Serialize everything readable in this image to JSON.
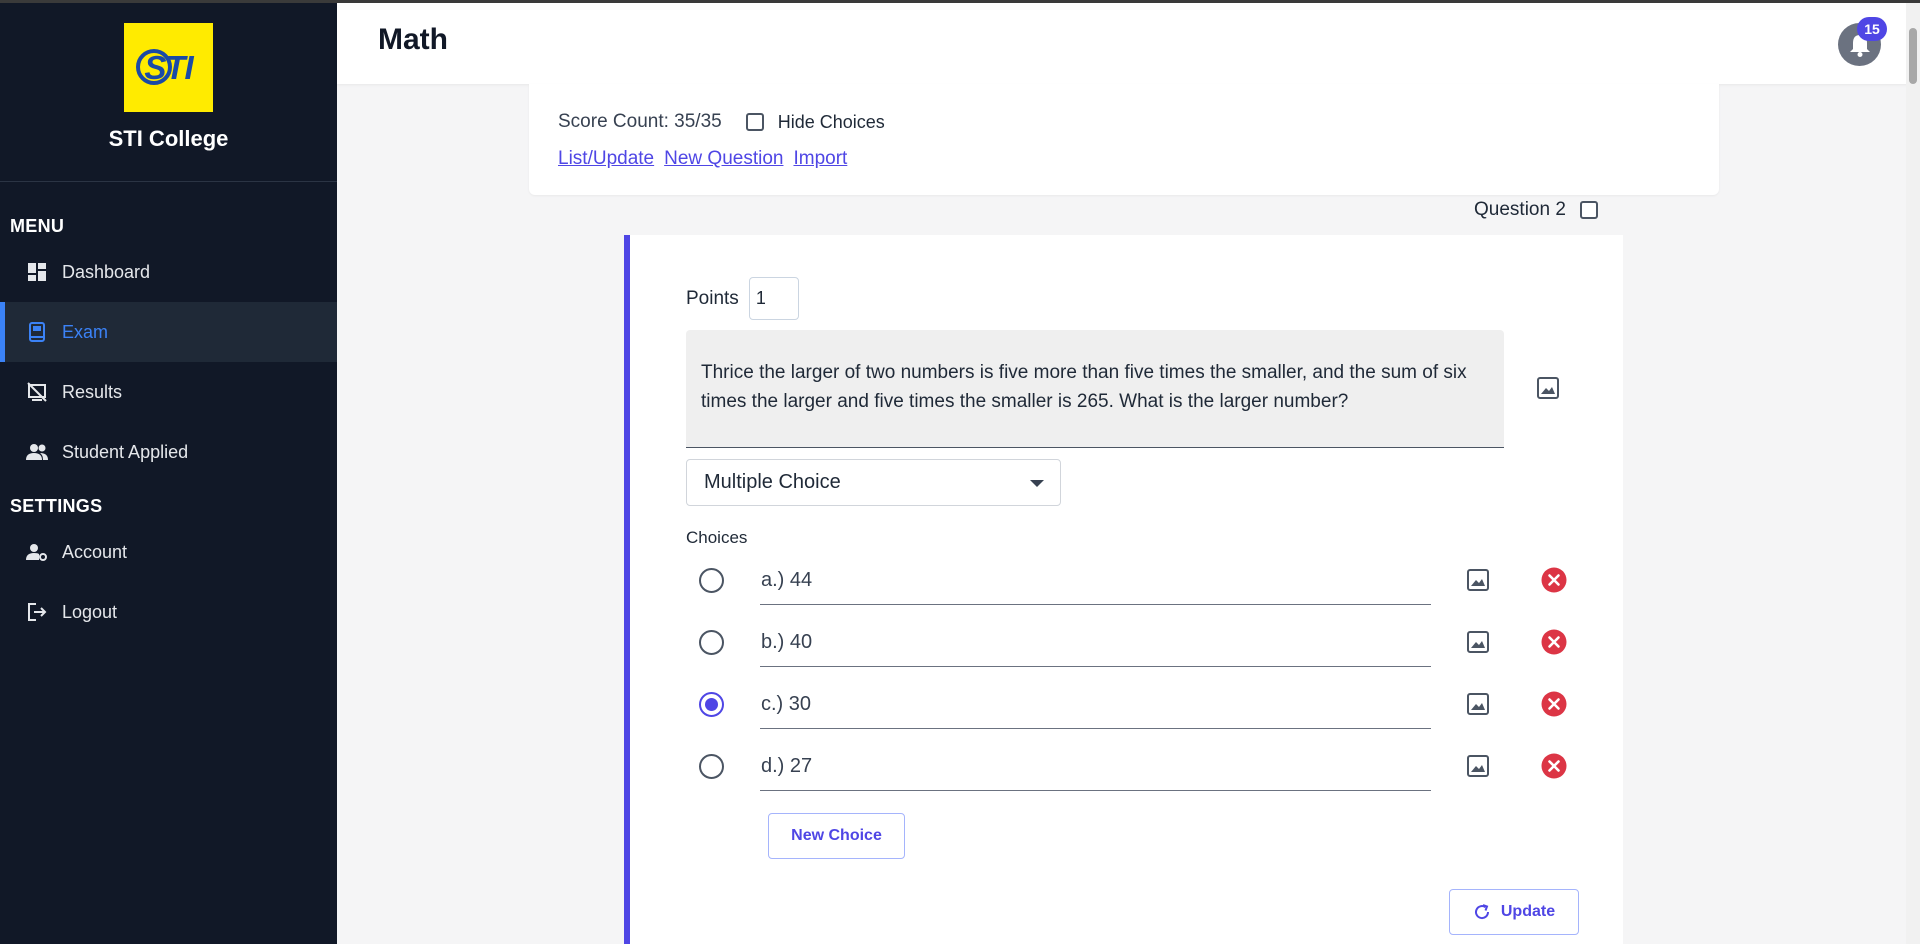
{
  "sidebar": {
    "logo_text": "STI",
    "brand_name": "STI College",
    "menu_title": "MENU",
    "menu_items": [
      {
        "label": "Dashboard",
        "icon": "dashboard-icon"
      },
      {
        "label": "Exam",
        "icon": "exam-book-icon",
        "active": true
      },
      {
        "label": "Results",
        "icon": "results-icon"
      },
      {
        "label": "Student Applied",
        "icon": "people-icon"
      }
    ],
    "settings_title": "SETTINGS",
    "settings_items": [
      {
        "label": "Account",
        "icon": "account-settings-icon"
      },
      {
        "label": "Logout",
        "icon": "logout-icon"
      }
    ]
  },
  "header": {
    "title": "Math",
    "notification_count": "15"
  },
  "toolbar": {
    "score_count": "Score Count: 35/35",
    "hide_choices_label": "Hide Choices",
    "links": [
      "List/Update",
      "New Question",
      "Import"
    ]
  },
  "question": {
    "number_label": "Question 2",
    "points_label": "Points",
    "points_value": "1",
    "text": "Thrice the larger of two numbers is five more than five times the smaller, and the sum of six times the larger and five times the smaller is 265. What is the larger number?",
    "type": "Multiple Choice",
    "choices_label": "Choices",
    "choices": [
      {
        "text": "a.) 44",
        "selected": false
      },
      {
        "text": "b.) 40",
        "selected": false
      },
      {
        "text": "c.) 30",
        "selected": true
      },
      {
        "text": "d.) 27",
        "selected": false
      }
    ],
    "new_choice_label": "New Choice",
    "update_label": "Update"
  },
  "colors": {
    "accent": "#4f46e5",
    "sidebar_bg": "#111827",
    "active_nav": "#3b82f6",
    "delete": "#dc3545",
    "logo_bg": "#ffeb00"
  }
}
